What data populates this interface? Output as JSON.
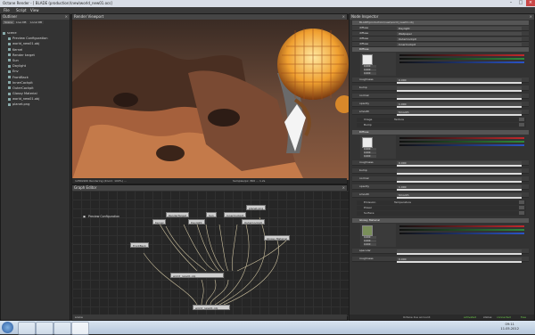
{
  "window": {
    "title": "Octane Render - [ BLADE (production)\\new\\world_new01.ocs]"
  },
  "menu": [
    "File",
    "Script",
    "View"
  ],
  "outliner": {
    "title": "Outliner",
    "tabs": [
      "Scene",
      "Live DB",
      "Local DB"
    ],
    "items": [
      "scene",
      "Preview Configuration",
      "world_new01.obj",
      "Kernel",
      "Render target",
      "Sun",
      "Daylight",
      "Env",
      "FrontBack",
      "InnerCockpit",
      "OuterCockpit",
      "Glossy Material",
      "world_new01.obj",
      "planet.png"
    ]
  },
  "viewport": {
    "title": "Render Viewport",
    "status_left": "1280x960 Rendering (Zoom: 100%) ...",
    "status_right": "Samples/px: 800 ... 1.2s"
  },
  "graph": {
    "title": "Graph Editor",
    "tab": "scene",
    "nodes": [
      "Preview Configuration",
      "Kernel",
      "RenderTarget",
      "Daylight",
      "Sun",
      "InnerCockpit",
      "planet.png",
      "OuterCockpit",
      "Glossy Material",
      "FrontBack",
      "world_new01.obj",
      "world_new01.obj"
    ]
  },
  "inspector": {
    "title": "Node Inspector",
    "path": "BLADE\\production\\new\\world_new01.obj",
    "top_rows": [
      {
        "k": "diffuse",
        "v": "Daylight"
      },
      {
        "k": "diffuse",
        "v": "Wallpaper"
      },
      {
        "k": "diffuse",
        "v": "OuterCockpit"
      },
      {
        "k": "diffuse",
        "v": "InnerCockpit"
      }
    ],
    "sections": [
      {
        "head": "Diffuse",
        "color": "#ececec",
        "values": [
          "0.000",
          "0.000",
          "0.000"
        ],
        "rows": [
          {
            "k": "roughness",
            "v": "0.000"
          },
          {
            "k": "bump",
            "v": ""
          },
          {
            "k": "normal",
            "v": ""
          },
          {
            "k": "opacity",
            "v": "1.000"
          },
          {
            "k": "smooth",
            "v": "Smooth"
          }
        ],
        "sub": [
          {
            "k": "Image",
            "v": "Texture"
          },
          {
            "k": "Bump",
            "v": ""
          }
        ]
      },
      {
        "head": "Diffuse",
        "color": "#ececec",
        "values": [
          "0.000",
          "0.000",
          "0.000"
        ],
        "rows": [
          {
            "k": "roughness",
            "v": "0.000"
          },
          {
            "k": "bump",
            "v": ""
          },
          {
            "k": "normal",
            "v": ""
          },
          {
            "k": "opacity",
            "v": "1.000"
          },
          {
            "k": "smooth",
            "v": "Smooth"
          }
        ],
        "sub": [
          {
            "k": "Emission",
            "v": "Temperature"
          },
          {
            "k": "Power",
            "v": ""
          },
          {
            "k": "Surface",
            "v": ""
          }
        ]
      },
      {
        "head": "Glossy Material",
        "color": "#7a8f5a",
        "values": [
          "0.000",
          "0.000",
          "0.000"
        ],
        "rows": [
          {
            "k": "specular",
            "v": ""
          },
          {
            "k": "roughness",
            "v": "0.000"
          }
        ],
        "sub": []
      }
    ],
    "status": {
      "label_a": "Octane live account:",
      "value_a": "activated",
      "label_b": "status:",
      "value_b": "connected",
      "label_c": "",
      "value_c": "free"
    }
  },
  "taskbar": {
    "time": "09:11",
    "date": "11.05.2012"
  },
  "colors": {
    "accent_green": "#6fcf4a",
    "red": "#c0282c",
    "blue": "#2a53c7",
    "bar_green": "#2e8a3a"
  }
}
